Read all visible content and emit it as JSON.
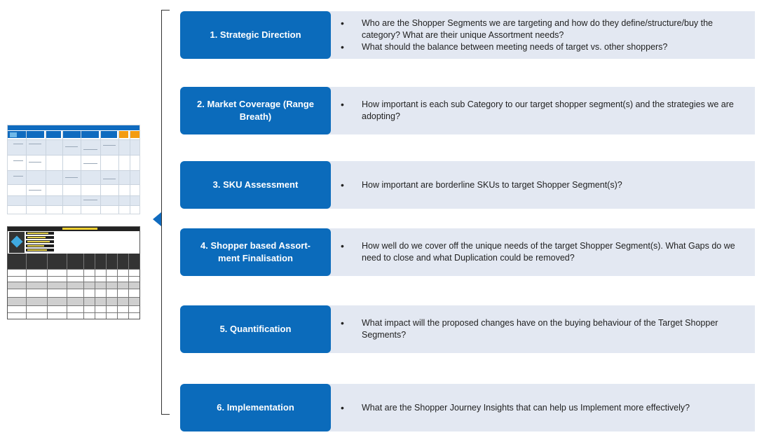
{
  "steps": [
    {
      "title": "1. Strategic Direction",
      "bullets": [
        "Who are the Shopper Segments we are targeting and how do they define/structure/buy the category? What are their unique Assortment needs?",
        "What should the balance between meeting needs of target vs. other shoppers?"
      ]
    },
    {
      "title": "2. Market Coverage (Range Breath)",
      "bullets": [
        "How important is each sub Category to our target shopper segment(s) and the strategies we are adopting?"
      ]
    },
    {
      "title": "3. SKU Assessment",
      "bullets": [
        "How important are borderline SKUs to target Shopper Segment(s)?"
      ]
    },
    {
      "title": "4. Shopper based Assort-ment Finalisation",
      "bullets": [
        "How well do we cover off the unique needs of the target Shopper Segment(s). What Gaps do we need to close and what Duplication could be removed?"
      ]
    },
    {
      "title": "5. Quantification",
      "bullets": [
        "What impact will the proposed changes have on the buying behaviour of the Target Shopper Segments?"
      ]
    },
    {
      "title": "6. Implementation",
      "bullets": [
        "What are the Shopper Journey Insights that can help us Implement more effectively?"
      ]
    }
  ],
  "colors": {
    "step_box": "#0b6bbb",
    "step_bg": "#e3e8f2",
    "pointer": "#0f6bbf"
  }
}
